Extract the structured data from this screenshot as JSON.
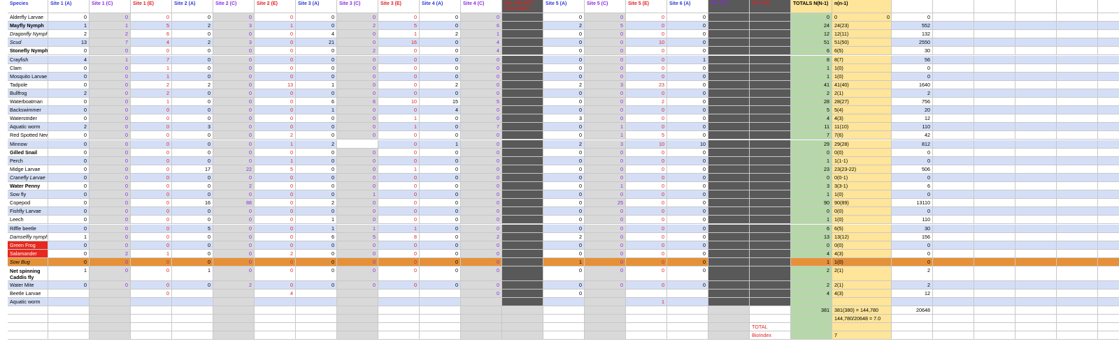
{
  "columns": [
    {
      "label": "Species",
      "w": 58,
      "type": "sp"
    },
    {
      "label": "Site 1 (A)",
      "w": 59,
      "type": "A"
    },
    {
      "label": "Site 1 (C)",
      "w": 59,
      "type": "C"
    },
    {
      "label": "Site 1 (E)",
      "w": 59,
      "type": "E"
    },
    {
      "label": "Site 2 (A)",
      "w": 59,
      "type": "A"
    },
    {
      "label": "Site 2 (C)",
      "w": 59,
      "type": "C"
    },
    {
      "label": "Site 2 (E)",
      "w": 59,
      "type": "E"
    },
    {
      "label": "Site 3 (A)",
      "w": 59,
      "type": "A"
    },
    {
      "label": "Site 3 (C)",
      "w": 59,
      "type": "C"
    },
    {
      "label": "Site 3 (E)",
      "w": 59,
      "type": "E"
    },
    {
      "label": "Site 4 (A)",
      "w": 59,
      "type": "A"
    },
    {
      "label": "Site 4 (C)",
      "w": 59,
      "type": "C"
    },
    {
      "label": "Site 4 (E) (NOT AVAILABLE)",
      "w": 59,
      "type": "dark"
    },
    {
      "label": "Site 5 (A)",
      "w": 59,
      "type": "A"
    },
    {
      "label": "Site 5 (C)",
      "w": 59,
      "type": "C"
    },
    {
      "label": "Site 5 (E)",
      "w": 59,
      "type": "E"
    },
    {
      "label": "Site 6 (A)",
      "w": 59,
      "type": "A"
    },
    {
      "label": "Site 6 (C)",
      "w": 59,
      "type": "dark"
    },
    {
      "label": "Site 6 (E)",
      "w": 59,
      "type": "dark"
    },
    {
      "label": "TOTALS N(N-1)",
      "w": 59,
      "type": "tot"
    },
    {
      "label": "n(n-1)",
      "w": 85,
      "type": "nn"
    },
    {
      "label": "",
      "w": 59,
      "type": "prod"
    },
    {
      "label": "",
      "w": 59,
      "type": "empty"
    },
    {
      "label": "",
      "w": 59,
      "type": "empty"
    },
    {
      "label": "",
      "w": 59,
      "type": "empty"
    },
    {
      "label": "",
      "w": 59,
      "type": "empty"
    },
    {
      "label": "",
      "w": 59,
      "type": "empty"
    }
  ],
  "rows": [
    {
      "name": "Alderfly Larvae",
      "vals": [
        "0",
        "0",
        "0",
        "0",
        "0",
        "0",
        "0",
        "0",
        "0",
        "0",
        "0",
        "",
        "0",
        "0",
        "0",
        "0",
        "",
        "",
        "0",
        "0",
        "0"
      ]
    },
    {
      "name": "Mayfly Nymph",
      "style": "bold",
      "vals": [
        "1",
        "1",
        "5",
        "2",
        "3",
        "1",
        "0",
        "2",
        "5",
        "0",
        "6",
        "",
        "2",
        "5",
        "0",
        "0",
        "",
        "",
        "24",
        "24(23)",
        "552"
      ]
    },
    {
      "name": "Dragonfly Nymph",
      "style": "ital",
      "vals": [
        "2",
        "2",
        "6",
        "0",
        "0",
        "0",
        "4",
        "0",
        "1",
        "2",
        "1",
        "",
        "0",
        "0",
        "0",
        "0",
        "",
        "",
        "12",
        "12(11)",
        "132"
      ]
    },
    {
      "name": "Scud",
      "style": "ital",
      "vals": [
        "13",
        "7",
        "4",
        "2",
        "3",
        "0",
        "21",
        "0",
        "16",
        "0",
        "4",
        "",
        "0",
        "0",
        "10",
        "0",
        "",
        "",
        "51",
        "51(50)",
        "2550"
      ]
    },
    {
      "name": "Stonefly Nymph",
      "style": "bold",
      "vals": [
        "0",
        "0",
        "0",
        "0",
        "0",
        "0",
        "0",
        "2",
        "0",
        "0",
        "4",
        "",
        "0",
        "0",
        "0",
        "0",
        "",
        "",
        "6",
        "6(5)",
        "30"
      ]
    },
    {
      "name": "Crayfish",
      "vals": [
        "4",
        "1",
        "7",
        "0",
        "0",
        "0",
        "0",
        "0",
        "0",
        "0",
        "0",
        "",
        "0",
        "0",
        "0",
        "1",
        "",
        "",
        "8",
        "8(7)",
        "56"
      ]
    },
    {
      "name": "Clam",
      "vals": [
        "0",
        "0",
        "1",
        "0",
        "0",
        "0",
        "0",
        "0",
        "0",
        "0",
        "0",
        "",
        "0",
        "0",
        "0",
        "0",
        "",
        "",
        "1",
        "1(0)",
        "0"
      ]
    },
    {
      "name": "Mosquito Larvae",
      "vals": [
        "0",
        "0",
        "1",
        "0",
        "0",
        "0",
        "0",
        "0",
        "0",
        "0",
        "0",
        "",
        "0",
        "0",
        "0",
        "0",
        "",
        "",
        "1",
        "1(0)",
        "0"
      ]
    },
    {
      "name": "Tadpole",
      "vals": [
        "0",
        "0",
        "2",
        "2",
        "0",
        "13",
        "1",
        "0",
        "0",
        "2",
        "0",
        "",
        "2",
        "3",
        "23",
        "0",
        "",
        "",
        "41",
        "41(40)",
        "1640"
      ]
    },
    {
      "name": "Bullfrog",
      "vals": [
        "2",
        "0",
        "2",
        "0",
        "0",
        "0",
        "0",
        "0",
        "0",
        "0",
        "0",
        "",
        "0",
        "0",
        "0",
        "0",
        "",
        "",
        "2",
        "2(1)",
        "2"
      ]
    },
    {
      "name": "Waterboatman",
      "vals": [
        "0",
        "0",
        "1",
        "0",
        "0",
        "0",
        "6",
        "6",
        "10",
        "15",
        "5",
        "",
        "0",
        "0",
        "2",
        "0",
        "",
        "",
        "28",
        "28(27)",
        "756"
      ]
    },
    {
      "name": "Backswimmer",
      "vals": [
        "0",
        "0",
        "0",
        "0",
        "0",
        "0",
        "1",
        "0",
        "0",
        "4",
        "0",
        "",
        "0",
        "0",
        "0",
        "0",
        "",
        "",
        "5",
        "5(4)",
        "20"
      ]
    },
    {
      "name": "Waterstrider",
      "vals": [
        "0",
        "0",
        "0",
        "0",
        "0",
        "0",
        "0",
        "0",
        "1",
        "0",
        "0",
        "",
        "3",
        "0",
        "0",
        "0",
        "",
        "",
        "4",
        "4(3)",
        "12"
      ]
    },
    {
      "name": "Aquatic worm",
      "vals": [
        "2",
        "0",
        "0",
        "3",
        "0",
        "0",
        "0",
        "0",
        "1",
        "0",
        "7",
        "",
        "0",
        "1",
        "0",
        "0",
        "",
        "",
        "11",
        "11(10)",
        "110"
      ]
    },
    {
      "name": "Red Spotted Newt",
      "vals": [
        "0",
        "0",
        "0",
        "0",
        "0",
        "2",
        "0",
        "0",
        "0",
        "0",
        "0",
        "",
        "0",
        "1",
        "5",
        "0",
        "",
        "",
        "7",
        "7(6)",
        "42"
      ]
    },
    {
      "name": "Minnow",
      "vals": [
        "0",
        "0",
        "0",
        "0",
        "0",
        "1",
        "2",
        "",
        "0",
        "1",
        "0",
        "",
        "2",
        "3",
        "10",
        "10",
        "",
        "",
        "29",
        "29(28)",
        "812"
      ]
    },
    {
      "name": "Gilled Snail",
      "style": "bold",
      "vals": [
        "0",
        "0",
        "0",
        "0",
        "0",
        "0",
        "0",
        "0",
        "0",
        "0",
        "0",
        "",
        "0",
        "0",
        "0",
        "0",
        "",
        "",
        "0",
        "0(0)",
        "0"
      ]
    },
    {
      "name": "Perch",
      "vals": [
        "0",
        "0",
        "0",
        "0",
        "0",
        "1",
        "0",
        "0",
        "0",
        "0",
        "0",
        "",
        "0",
        "0",
        "0",
        "0",
        "",
        "",
        "1",
        "1(1-1)",
        "0"
      ]
    },
    {
      "name": "Midge Larvae",
      "vals": [
        "0",
        "0",
        "0",
        "17",
        "22",
        "5",
        "0",
        "0",
        "1",
        "0",
        "0",
        "",
        "0",
        "0",
        "0",
        "0",
        "",
        "",
        "23",
        "23(23-22)",
        "506"
      ]
    },
    {
      "name": "Cranefly Larvae",
      "style": "ital",
      "vals": [
        "0",
        "0",
        "0",
        "0",
        "0",
        "0",
        "0",
        "0",
        "0",
        "0",
        "0",
        "",
        "0",
        "0",
        "0",
        "0",
        "",
        "",
        "0",
        "0(0-1)",
        "0"
      ]
    },
    {
      "name": "Water Penny",
      "style": "bold",
      "vals": [
        "0",
        "0",
        "0",
        "0",
        "2",
        "0",
        "0",
        "0",
        "0",
        "0",
        "0",
        "",
        "0",
        "1",
        "0",
        "0",
        "",
        "",
        "3",
        "3(3-1)",
        "6"
      ]
    },
    {
      "name": "Sow fly",
      "vals": [
        "0",
        "0",
        "0",
        "0",
        "0",
        "0",
        "0",
        "1",
        "0",
        "0",
        "0",
        "",
        "0",
        "0",
        "0",
        "0",
        "",
        "",
        "1",
        "1(0)",
        "0"
      ]
    },
    {
      "name": "Copepod",
      "vals": [
        "0",
        "0",
        "0",
        "16",
        "88",
        "0",
        "2",
        "0",
        "0",
        "0",
        "0",
        "",
        "0",
        "25",
        "0",
        "0",
        "",
        "",
        "90",
        "90(89)",
        "13110"
      ]
    },
    {
      "name": "Fishfly Larvae",
      "vals": [
        "0",
        "0",
        "0",
        "0",
        "0",
        "0",
        "0",
        "0",
        "0",
        "0",
        "0",
        "",
        "0",
        "0",
        "0",
        "0",
        "",
        "",
        "0",
        "0(0)",
        "0"
      ]
    },
    {
      "name": "Leech",
      "vals": [
        "0",
        "0",
        "0",
        "0",
        "0",
        "0",
        "1",
        "0",
        "0",
        "0",
        "0",
        "",
        "0",
        "0",
        "0",
        "0",
        "",
        "",
        "1",
        "1(0)",
        "110"
      ]
    },
    {
      "name": "Riffle beetle",
      "vals": [
        "0",
        "0",
        "0",
        "5",
        "0",
        "0",
        "1",
        "1",
        "1",
        "0",
        "0",
        "",
        "0",
        "0",
        "0",
        "0",
        "",
        "",
        "6",
        "6(5)",
        "30"
      ]
    },
    {
      "name": "Damselfly nymph",
      "style": "ital",
      "vals": [
        "1",
        "0",
        "0",
        "0",
        "0",
        "0",
        "6",
        "5",
        "8",
        "0",
        "2",
        "",
        "2",
        "0",
        "0",
        "0",
        "",
        "",
        "13",
        "13(12)",
        "156"
      ]
    },
    {
      "name": "Green Frog",
      "style": "redname",
      "vals": [
        "0",
        "0",
        "0",
        "0",
        "0",
        "0",
        "0",
        "0",
        "0",
        "0",
        "0",
        "",
        "0",
        "0",
        "0",
        "0",
        "",
        "",
        "0",
        "0(0)",
        "0"
      ]
    },
    {
      "name": "Salamander",
      "style": "redname",
      "vals": [
        "0",
        "2",
        "1",
        "0",
        "0",
        "2",
        "0",
        "0",
        "0",
        "0",
        "0",
        "",
        "0",
        "0",
        "0",
        "0",
        "",
        "",
        "4",
        "4(3)",
        "0"
      ]
    },
    {
      "name": "Sow Bug",
      "style": "orange",
      "vals": [
        "0",
        "0",
        "0",
        "0",
        "0",
        "0",
        "0",
        "0",
        "0",
        "0",
        "0",
        "",
        "1",
        "0",
        "0",
        "0",
        "",
        "",
        "1",
        "1(0)",
        "0"
      ]
    },
    {
      "name": "Net spinning Caddis fly",
      "style": "bold",
      "tall": true,
      "vals": [
        "1",
        "0",
        "0",
        "1",
        "0",
        "0",
        "0",
        "0",
        "0",
        "0",
        "0",
        "",
        "0",
        "0",
        "0",
        "0",
        "",
        "",
        "2",
        "2(1)",
        "2"
      ]
    },
    {
      "name": "Water Mite",
      "vals": [
        "0",
        "0",
        "0",
        "0",
        "2",
        "0",
        "0",
        "0",
        "0",
        "0",
        "0",
        "",
        "0",
        "0",
        "0",
        "0",
        "",
        "",
        "2",
        "2(1)",
        "2"
      ]
    },
    {
      "name": "Beetle Larvae",
      "vals": [
        "",
        "",
        "0",
        "",
        "",
        "4",
        "",
        "",
        "",
        "",
        "0",
        "",
        "0",
        "",
        "",
        "",
        "",
        "",
        "4",
        "4(3)",
        "12"
      ]
    },
    {
      "name": "Aquatic worm",
      "vals": [
        "",
        "",
        "",
        "",
        "",
        "",
        "",
        "",
        "",
        "",
        "",
        "",
        "",
        "",
        "1",
        "",
        "",
        "",
        "",
        "",
        ""
      ]
    },
    {
      "name": "",
      "vals": [
        "",
        "",
        "",
        "",
        "",
        "",
        "",
        "",
        "",
        "",
        "",
        "",
        "",
        "",
        "",
        "",
        "",
        "",
        "381",
        "381(380) = 144,780",
        "20648"
      ]
    },
    {
      "name": "",
      "vals": [
        "",
        "",
        "",
        "",
        "",
        "",
        "",
        "",
        "",
        "",
        "",
        "",
        "",
        "",
        "",
        "",
        "",
        "",
        "",
        "144,780/20648 = 7.0",
        ""
      ]
    },
    {
      "name": "",
      "vals": [
        "",
        "",
        "",
        "",
        "",
        "",
        "",
        "",
        "",
        "",
        "",
        "",
        "",
        "",
        "",
        "",
        "",
        "TOTAL",
        "",
        "",
        ""
      ]
    },
    {
      "name": "",
      "vals": [
        "",
        "",
        "",
        "",
        "",
        "",
        "",
        "",
        "",
        "",
        "",
        "",
        "",
        "",
        "",
        "",
        "",
        "BioIndex",
        "",
        "7",
        ""
      ]
    }
  ],
  "extra_cells": {
    "row0_nn_value": "0"
  },
  "colors": {
    "blue_row": "#d4dff7",
    "gray_c": "#d9d9d9",
    "dark": "#595959",
    "green": "#b6d7a8",
    "yellow": "#ffe599",
    "orange": "#e69138",
    "red_cell": "#e8281e",
    "text_A": "#2b3ad6",
    "text_C": "#8a2be2",
    "text_E": "#e02020"
  }
}
